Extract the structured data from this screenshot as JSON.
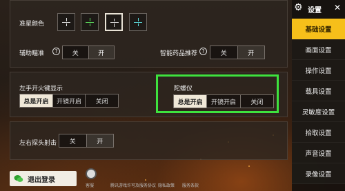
{
  "crosshair": {
    "label": "准星颜色",
    "options": [
      {
        "color": "white"
      },
      {
        "color": "green"
      },
      {
        "color": "white"
      },
      {
        "color": "cyan"
      }
    ],
    "selected_index": 2
  },
  "assist_aim": {
    "label": "辅助瞄准",
    "off": "关",
    "on": "开",
    "help": "?"
  },
  "smart_meds": {
    "label": "智能药品推荐",
    "off": "关",
    "on": "开",
    "help": "?"
  },
  "left_fire": {
    "label": "左手开火键显示",
    "options": [
      "总是开启",
      "开镜开启",
      "关闭"
    ]
  },
  "gyro": {
    "label": "陀螺仪",
    "options": [
      "总是开启",
      "开镜开启",
      "关闭"
    ]
  },
  "peek_fire": {
    "label": "左右探头射击",
    "off": "关",
    "on": "开"
  },
  "sidebar": {
    "title": "设置",
    "close": "✕",
    "items": [
      {
        "label": "基础设置",
        "active": true
      },
      {
        "label": "画面设置",
        "active": false
      },
      {
        "label": "操作设置",
        "active": false
      },
      {
        "label": "载具设置",
        "active": false
      },
      {
        "label": "灵敏度设置",
        "active": false
      },
      {
        "label": "拾取设置",
        "active": false
      },
      {
        "label": "声音设置",
        "active": false
      },
      {
        "label": "录像设置",
        "active": false
      }
    ]
  },
  "bottom": {
    "logout": "退出登录",
    "service": "客服",
    "links": [
      "腾讯游戏许可及服务协议",
      "隐私政策",
      "服务条款"
    ]
  },
  "colors": {
    "accent": "#f6bf1a",
    "highlight_box": "#3ee23e"
  }
}
